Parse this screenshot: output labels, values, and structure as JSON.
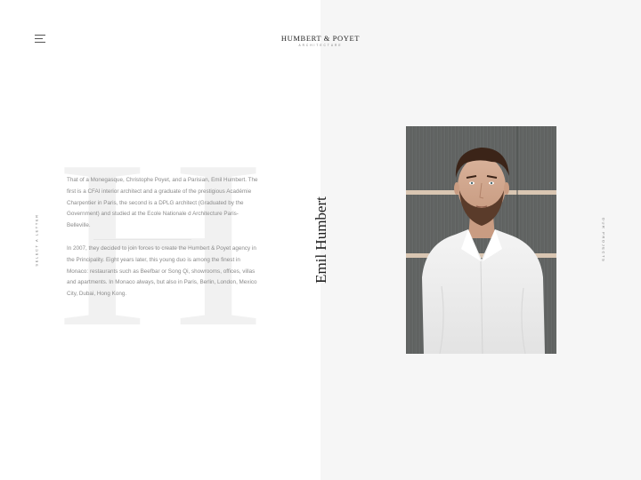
{
  "header": {
    "logo_title": "HUMBERT & POYET",
    "logo_subtitle": "ARCHITECTURE"
  },
  "side_nav": {
    "left_label": "SELECT A LETTER",
    "right_label": "OUR PROJECTS"
  },
  "bio": {
    "letter": "H",
    "paragraph_1": "That of a Monegasque, Christophe Poyet, and a Parisian, Emil Humbert. The first is a CFAI interior architect and a graduate of the prestigious Académie Charpentier in Paris, the second is a DPLG architect (Graduated by the Government) and studied at the Ecole Nationale d Architecture Paris-Belleville.",
    "paragraph_2": "In 2007, they decided to join forces to create the Humbert & Poyet agency in the Principality. Eight years later, this young duo is among the finest in Monaco: restaurants such as Beefbar or Song Qi, showrooms, offices, villas and apartments. In Monaco always, but also in Paris, Berlin, London, Mexico City, Dubai, Hong Kong."
  },
  "person": {
    "name": "Emil Humbert"
  },
  "colors": {
    "left_bg": "#ffffff",
    "right_bg": "#f6f6f6",
    "text": "#8a8a8a",
    "heading": "#1e1e1e"
  },
  "icons": {
    "menu": "hamburger-menu-icon"
  }
}
